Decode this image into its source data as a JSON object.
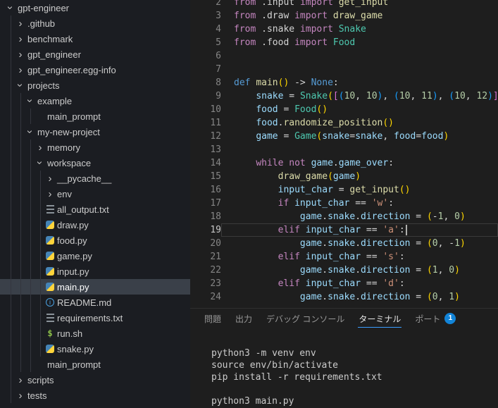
{
  "colors": {
    "editor_background": "#1e1e1e",
    "sidebar_background": "#1b1d22",
    "selection_background": "#3a4049",
    "tab_active_underline": "#3b9eff",
    "badge_background": "#1284d8",
    "syntax": {
      "keyword": "#C586C0",
      "keyword_decl": "#569CD6",
      "function": "#DCDCAA",
      "class": "#4EC9B0",
      "variable": "#9CDCFE",
      "number": "#B5CEA8",
      "string": "#CE9178",
      "default": "#D4D4D4",
      "bracket1": "#FFD700",
      "bracket2": "#DA70D6",
      "bracket3": "#179FFF"
    }
  },
  "sidebar": {
    "items": [
      {
        "label": "gpt-engineer",
        "depth": 0,
        "kind": "folder",
        "expanded": true
      },
      {
        "label": ".github",
        "depth": 1,
        "kind": "folder",
        "expanded": false
      },
      {
        "label": "benchmark",
        "depth": 1,
        "kind": "folder",
        "expanded": false
      },
      {
        "label": "gpt_engineer",
        "depth": 1,
        "kind": "folder",
        "expanded": false
      },
      {
        "label": "gpt_engineer.egg-info",
        "depth": 1,
        "kind": "folder",
        "expanded": false
      },
      {
        "label": "projects",
        "depth": 1,
        "kind": "folder",
        "expanded": true
      },
      {
        "label": "example",
        "depth": 2,
        "kind": "folder",
        "expanded": true
      },
      {
        "label": "main_prompt",
        "depth": 3,
        "kind": "file",
        "icon": "file"
      },
      {
        "label": "my-new-project",
        "depth": 2,
        "kind": "folder",
        "expanded": true
      },
      {
        "label": "memory",
        "depth": 3,
        "kind": "folder",
        "expanded": false
      },
      {
        "label": "workspace",
        "depth": 3,
        "kind": "folder",
        "expanded": true
      },
      {
        "label": "__pycache__",
        "depth": 4,
        "kind": "folder",
        "expanded": false
      },
      {
        "label": "env",
        "depth": 4,
        "kind": "folder",
        "expanded": false
      },
      {
        "label": "all_output.txt",
        "depth": 4,
        "kind": "file",
        "icon": "text"
      },
      {
        "label": "draw.py",
        "depth": 4,
        "kind": "file",
        "icon": "python"
      },
      {
        "label": "food.py",
        "depth": 4,
        "kind": "file",
        "icon": "python"
      },
      {
        "label": "game.py",
        "depth": 4,
        "kind": "file",
        "icon": "python"
      },
      {
        "label": "input.py",
        "depth": 4,
        "kind": "file",
        "icon": "python"
      },
      {
        "label": "main.py",
        "depth": 4,
        "kind": "file",
        "icon": "python",
        "selected": true
      },
      {
        "label": "README.md",
        "depth": 4,
        "kind": "file",
        "icon": "info"
      },
      {
        "label": "requirements.txt",
        "depth": 4,
        "kind": "file",
        "icon": "text"
      },
      {
        "label": "run.sh",
        "depth": 4,
        "kind": "file",
        "icon": "shell"
      },
      {
        "label": "snake.py",
        "depth": 4,
        "kind": "file",
        "icon": "python"
      },
      {
        "label": "main_prompt",
        "depth": 3,
        "kind": "file",
        "icon": "file"
      },
      {
        "label": "scripts",
        "depth": 1,
        "kind": "folder",
        "expanded": false
      },
      {
        "label": "tests",
        "depth": 1,
        "kind": "folder",
        "expanded": false
      }
    ]
  },
  "editor": {
    "lines": [
      {
        "n": 2,
        "t": [
          [
            "k",
            "from"
          ],
          [
            "p",
            " .input "
          ],
          [
            "k",
            "import"
          ],
          [
            "f",
            " get_input"
          ]
        ]
      },
      {
        "n": 3,
        "t": [
          [
            "k",
            "from"
          ],
          [
            "p",
            " .draw "
          ],
          [
            "k",
            "import"
          ],
          [
            "f",
            " draw_game"
          ]
        ]
      },
      {
        "n": 4,
        "t": [
          [
            "k",
            "from"
          ],
          [
            "p",
            " .snake "
          ],
          [
            "k",
            "import"
          ],
          [
            "c",
            " Snake"
          ]
        ]
      },
      {
        "n": 5,
        "t": [
          [
            "k",
            "from"
          ],
          [
            "p",
            " .food "
          ],
          [
            "k",
            "import"
          ],
          [
            "c",
            " Food"
          ]
        ]
      },
      {
        "n": 6,
        "t": []
      },
      {
        "n": 7,
        "t": []
      },
      {
        "n": 8,
        "t": [
          [
            "d",
            "def"
          ],
          [
            "p",
            " "
          ],
          [
            "f",
            "main"
          ],
          [
            "b1",
            "()"
          ],
          [
            "p",
            " -> "
          ],
          [
            "d",
            "None"
          ],
          [
            "p",
            ":"
          ]
        ]
      },
      {
        "n": 9,
        "t": [
          [
            "p",
            "    "
          ],
          [
            "v",
            "snake"
          ],
          [
            "p",
            " = "
          ],
          [
            "c",
            "Snake"
          ],
          [
            "b1",
            "("
          ],
          [
            "b2",
            "["
          ],
          [
            "b3",
            "("
          ],
          [
            "n",
            "10"
          ],
          [
            "p",
            ", "
          ],
          [
            "n",
            "10"
          ],
          [
            "b3",
            ")"
          ],
          [
            "p",
            ", "
          ],
          [
            "b3",
            "("
          ],
          [
            "n",
            "10"
          ],
          [
            "p",
            ", "
          ],
          [
            "n",
            "11"
          ],
          [
            "b3",
            ")"
          ],
          [
            "p",
            ", "
          ],
          [
            "b3",
            "("
          ],
          [
            "n",
            "10"
          ],
          [
            "p",
            ", "
          ],
          [
            "n",
            "12"
          ],
          [
            "b3",
            ")"
          ],
          [
            "b2",
            "]"
          ]
        ]
      },
      {
        "n": 10,
        "t": [
          [
            "p",
            "    "
          ],
          [
            "v",
            "food"
          ],
          [
            "p",
            " = "
          ],
          [
            "c",
            "Food"
          ],
          [
            "b1",
            "()"
          ]
        ]
      },
      {
        "n": 11,
        "t": [
          [
            "p",
            "    "
          ],
          [
            "v",
            "food"
          ],
          [
            "p",
            "."
          ],
          [
            "f",
            "randomize_position"
          ],
          [
            "b1",
            "()"
          ]
        ]
      },
      {
        "n": 12,
        "t": [
          [
            "p",
            "    "
          ],
          [
            "v",
            "game"
          ],
          [
            "p",
            " = "
          ],
          [
            "c",
            "Game"
          ],
          [
            "b1",
            "("
          ],
          [
            "v",
            "snake"
          ],
          [
            "p",
            "="
          ],
          [
            "v",
            "snake"
          ],
          [
            "p",
            ", "
          ],
          [
            "v",
            "food"
          ],
          [
            "p",
            "="
          ],
          [
            "v",
            "food"
          ],
          [
            "b1",
            ")"
          ]
        ]
      },
      {
        "n": 13,
        "t": []
      },
      {
        "n": 14,
        "t": [
          [
            "p",
            "    "
          ],
          [
            "k",
            "while"
          ],
          [
            "p",
            " "
          ],
          [
            "k",
            "not"
          ],
          [
            "p",
            " "
          ],
          [
            "v",
            "game"
          ],
          [
            "p",
            "."
          ],
          [
            "v",
            "game_over"
          ],
          [
            "p",
            ":"
          ]
        ]
      },
      {
        "n": 15,
        "t": [
          [
            "p",
            "        "
          ],
          [
            "f",
            "draw_game"
          ],
          [
            "b1",
            "("
          ],
          [
            "v",
            "game"
          ],
          [
            "b1",
            ")"
          ]
        ]
      },
      {
        "n": 16,
        "t": [
          [
            "p",
            "        "
          ],
          [
            "v",
            "input_char"
          ],
          [
            "p",
            " = "
          ],
          [
            "f",
            "get_input"
          ],
          [
            "b1",
            "()"
          ]
        ]
      },
      {
        "n": 17,
        "t": [
          [
            "p",
            "        "
          ],
          [
            "k",
            "if"
          ],
          [
            "p",
            " "
          ],
          [
            "v",
            "input_char"
          ],
          [
            "p",
            " == "
          ],
          [
            "s",
            "'w'"
          ],
          [
            "p",
            ":"
          ]
        ]
      },
      {
        "n": 18,
        "t": [
          [
            "p",
            "            "
          ],
          [
            "v",
            "game"
          ],
          [
            "p",
            "."
          ],
          [
            "v",
            "snake"
          ],
          [
            "p",
            "."
          ],
          [
            "v",
            "direction"
          ],
          [
            "p",
            " = "
          ],
          [
            "b1",
            "("
          ],
          [
            "p",
            "-"
          ],
          [
            "n",
            "1"
          ],
          [
            "p",
            ", "
          ],
          [
            "n",
            "0"
          ],
          [
            "b1",
            ")"
          ]
        ]
      },
      {
        "n": 19,
        "t": [
          [
            "p",
            "        "
          ],
          [
            "k",
            "elif"
          ],
          [
            "p",
            " "
          ],
          [
            "v",
            "input_char"
          ],
          [
            "p",
            " == "
          ],
          [
            "s",
            "'a'"
          ],
          [
            "p",
            ":"
          ]
        ],
        "cursor": true
      },
      {
        "n": 20,
        "t": [
          [
            "p",
            "            "
          ],
          [
            "v",
            "game"
          ],
          [
            "p",
            "."
          ],
          [
            "v",
            "snake"
          ],
          [
            "p",
            "."
          ],
          [
            "v",
            "direction"
          ],
          [
            "p",
            " = "
          ],
          [
            "b1",
            "("
          ],
          [
            "n",
            "0"
          ],
          [
            "p",
            ", -"
          ],
          [
            "n",
            "1"
          ],
          [
            "b1",
            ")"
          ]
        ]
      },
      {
        "n": 21,
        "t": [
          [
            "p",
            "        "
          ],
          [
            "k",
            "elif"
          ],
          [
            "p",
            " "
          ],
          [
            "v",
            "input_char"
          ],
          [
            "p",
            " == "
          ],
          [
            "s",
            "'s'"
          ],
          [
            "p",
            ":"
          ]
        ]
      },
      {
        "n": 22,
        "t": [
          [
            "p",
            "            "
          ],
          [
            "v",
            "game"
          ],
          [
            "p",
            "."
          ],
          [
            "v",
            "snake"
          ],
          [
            "p",
            "."
          ],
          [
            "v",
            "direction"
          ],
          [
            "p",
            " = "
          ],
          [
            "b1",
            "("
          ],
          [
            "n",
            "1"
          ],
          [
            "p",
            ", "
          ],
          [
            "n",
            "0"
          ],
          [
            "b1",
            ")"
          ]
        ]
      },
      {
        "n": 23,
        "t": [
          [
            "p",
            "        "
          ],
          [
            "k",
            "elif"
          ],
          [
            "p",
            " "
          ],
          [
            "v",
            "input_char"
          ],
          [
            "p",
            " == "
          ],
          [
            "s",
            "'d'"
          ],
          [
            "p",
            ":"
          ]
        ]
      },
      {
        "n": 24,
        "t": [
          [
            "p",
            "            "
          ],
          [
            "v",
            "game"
          ],
          [
            "p",
            "."
          ],
          [
            "v",
            "snake"
          ],
          [
            "p",
            "."
          ],
          [
            "v",
            "direction"
          ],
          [
            "p",
            " = "
          ],
          [
            "b1",
            "("
          ],
          [
            "n",
            "0"
          ],
          [
            "p",
            ", "
          ],
          [
            "n",
            "1"
          ],
          [
            "b1",
            ")"
          ]
        ]
      }
    ]
  },
  "panel": {
    "tabs": [
      {
        "name": "problems",
        "label": "問題"
      },
      {
        "name": "output",
        "label": "出力"
      },
      {
        "name": "debug-console",
        "label": "デバッグ コンソール"
      },
      {
        "name": "terminal",
        "label": "ターミナル",
        "active": true
      },
      {
        "name": "ports",
        "label": "ポート",
        "badge": "1"
      }
    ]
  },
  "terminal": {
    "lines": [
      "python3 -m venv env",
      "source env/bin/activate",
      "pip install -r requirements.txt",
      "",
      "python3 main.py"
    ]
  }
}
